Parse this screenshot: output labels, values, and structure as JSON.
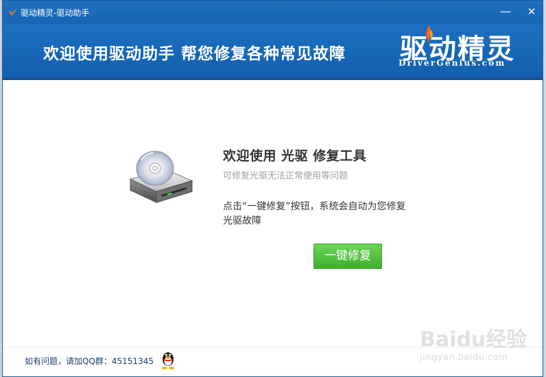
{
  "window": {
    "title": "驱动精灵-驱动助手",
    "minimize_label": "—",
    "close_label": "✕"
  },
  "banner": {
    "headline": "欢迎使用驱动助手  帮您修复各种常见故障",
    "brand_cn": "驱动精灵",
    "brand_en": "DriverGenius.com"
  },
  "main": {
    "icon": "optical-drive-icon",
    "title": "欢迎使用 光驱 修复工具",
    "subtitle": "可修复光驱无法正常使用等问题",
    "instruction": "点击“一键修复”按钮，系统会自动为您修复光驱故障",
    "repair_button": "一键修复"
  },
  "footer": {
    "help_text": "如有问题，请加QQ群：45151345",
    "qq_icon": "qq-penguin-icon"
  },
  "watermark": {
    "main": "Baidu经验",
    "sub": "jingyan.baidu.com"
  },
  "colors": {
    "titlebar": "#1f6fbd",
    "banner": "#1766b5",
    "button": "#4fbf3a",
    "brand_accent": "#f26a1b"
  }
}
